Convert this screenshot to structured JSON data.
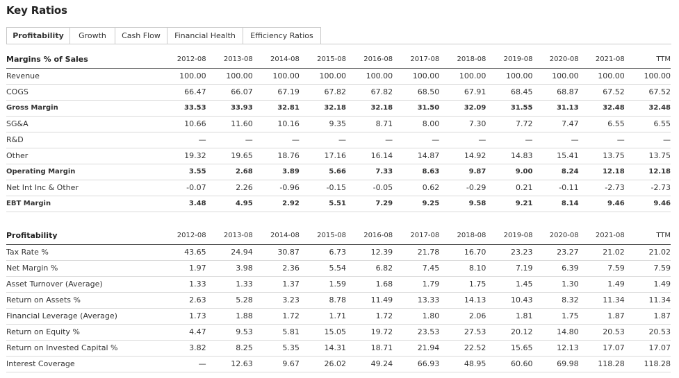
{
  "page": {
    "title": "Key Ratios"
  },
  "tabs": [
    "Profitability",
    "Growth",
    "Cash Flow",
    "Financial Health",
    "Efficiency Ratios"
  ],
  "active_tab": "Profitability",
  "columns": [
    "2012-08",
    "2013-08",
    "2014-08",
    "2015-08",
    "2016-08",
    "2017-08",
    "2018-08",
    "2019-08",
    "2020-08",
    "2021-08",
    "TTM"
  ],
  "margins_table": {
    "heading": "Margins % of Sales",
    "rows": [
      {
        "label": "Revenue",
        "bold": false,
        "values": [
          "100.00",
          "100.00",
          "100.00",
          "100.00",
          "100.00",
          "100.00",
          "100.00",
          "100.00",
          "100.00",
          "100.00",
          "100.00"
        ]
      },
      {
        "label": "COGS",
        "bold": false,
        "values": [
          "66.47",
          "66.07",
          "67.19",
          "67.82",
          "67.82",
          "68.50",
          "67.91",
          "68.45",
          "68.87",
          "67.52",
          "67.52"
        ]
      },
      {
        "label": "Gross Margin",
        "bold": true,
        "values": [
          "33.53",
          "33.93",
          "32.81",
          "32.18",
          "32.18",
          "31.50",
          "32.09",
          "31.55",
          "31.13",
          "32.48",
          "32.48"
        ]
      },
      {
        "label": "SG&A",
        "bold": false,
        "values": [
          "10.66",
          "11.60",
          "10.16",
          "9.35",
          "8.71",
          "8.00",
          "7.30",
          "7.72",
          "7.47",
          "6.55",
          "6.55"
        ]
      },
      {
        "label": "R&D",
        "bold": false,
        "values": [
          "—",
          "—",
          "—",
          "—",
          "—",
          "—",
          "—",
          "—",
          "—",
          "—",
          "—"
        ]
      },
      {
        "label": "Other",
        "bold": false,
        "values": [
          "19.32",
          "19.65",
          "18.76",
          "17.16",
          "16.14",
          "14.87",
          "14.92",
          "14.83",
          "15.41",
          "13.75",
          "13.75"
        ]
      },
      {
        "label": "Operating Margin",
        "bold": true,
        "values": [
          "3.55",
          "2.68",
          "3.89",
          "5.66",
          "7.33",
          "8.63",
          "9.87",
          "9.00",
          "8.24",
          "12.18",
          "12.18"
        ]
      },
      {
        "label": "Net Int Inc & Other",
        "bold": false,
        "values": [
          "-0.07",
          "2.26",
          "-0.96",
          "-0.15",
          "-0.05",
          "0.62",
          "-0.29",
          "0.21",
          "-0.11",
          "-2.73",
          "-2.73"
        ]
      },
      {
        "label": "EBT Margin",
        "bold": true,
        "values": [
          "3.48",
          "4.95",
          "2.92",
          "5.51",
          "7.29",
          "9.25",
          "9.58",
          "9.21",
          "8.14",
          "9.46",
          "9.46"
        ]
      }
    ]
  },
  "profitability_table": {
    "heading": "Profitability",
    "rows": [
      {
        "label": "Tax Rate %",
        "bold": false,
        "values": [
          "43.65",
          "24.94",
          "30.87",
          "6.73",
          "12.39",
          "21.78",
          "16.70",
          "23.23",
          "23.27",
          "21.02",
          "21.02"
        ]
      },
      {
        "label": "Net Margin %",
        "bold": false,
        "values": [
          "1.97",
          "3.98",
          "2.36",
          "5.54",
          "6.82",
          "7.45",
          "8.10",
          "7.19",
          "6.39",
          "7.59",
          "7.59"
        ]
      },
      {
        "label": "Asset Turnover (Average)",
        "bold": false,
        "values": [
          "1.33",
          "1.33",
          "1.37",
          "1.59",
          "1.68",
          "1.79",
          "1.75",
          "1.45",
          "1.30",
          "1.49",
          "1.49"
        ]
      },
      {
        "label": "Return on Assets %",
        "bold": false,
        "values": [
          "2.63",
          "5.28",
          "3.23",
          "8.78",
          "11.49",
          "13.33",
          "14.13",
          "10.43",
          "8.32",
          "11.34",
          "11.34"
        ]
      },
      {
        "label": "Financial Leverage (Average)",
        "bold": false,
        "values": [
          "1.73",
          "1.88",
          "1.72",
          "1.71",
          "1.72",
          "1.80",
          "2.06",
          "1.81",
          "1.75",
          "1.87",
          "1.87"
        ]
      },
      {
        "label": "Return on Equity %",
        "bold": false,
        "values": [
          "4.47",
          "9.53",
          "5.81",
          "15.05",
          "19.72",
          "23.53",
          "27.53",
          "20.12",
          "14.80",
          "20.53",
          "20.53"
        ]
      },
      {
        "label": "Return on Invested Capital %",
        "bold": false,
        "values": [
          "3.82",
          "8.25",
          "5.35",
          "14.31",
          "18.71",
          "21.94",
          "22.52",
          "15.65",
          "12.13",
          "17.07",
          "17.07"
        ]
      },
      {
        "label": "Interest Coverage",
        "bold": false,
        "values": [
          "—",
          "12.63",
          "9.67",
          "26.02",
          "49.24",
          "66.93",
          "48.95",
          "60.60",
          "69.98",
          "118.28",
          "118.28"
        ]
      }
    ]
  }
}
